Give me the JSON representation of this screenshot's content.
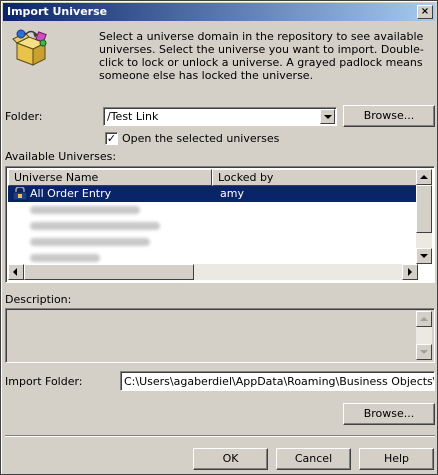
{
  "window": {
    "title": "Import Universe",
    "close_glyph": "×"
  },
  "intro_text": "Select a universe domain in the repository to see available universes. Select the universe you want to import. Double-click to lock or unlock a universe. A grayed padlock means someone else has locked the universe.",
  "folder": {
    "label": "Folder:",
    "value": "/Test Link",
    "browse_label": "Browse..."
  },
  "open_selected": {
    "label": "Open the selected universes",
    "checked": true,
    "check_glyph": "✓"
  },
  "available_universes": {
    "label": "Available Universes:",
    "columns": [
      "Universe Name",
      "Locked by"
    ],
    "rows": [
      {
        "name": "All Order Entry",
        "locked_by": "amy",
        "selected": true,
        "icon": "padlock-universe-icon"
      }
    ]
  },
  "description": {
    "label": "Description:"
  },
  "import_folder": {
    "label": "Import Folder:",
    "value": "C:\\Users\\agaberdiel\\AppData\\Roaming\\Business Objects\\Busine",
    "browse_label": "Browse..."
  },
  "buttons": {
    "ok": "OK",
    "cancel": "Cancel",
    "help": "Help"
  },
  "colors": {
    "titlebar_start": "#0a246a",
    "titlebar_end": "#a6caf0",
    "selection": "#0a246a",
    "dialog_face": "#d4d0c8"
  }
}
